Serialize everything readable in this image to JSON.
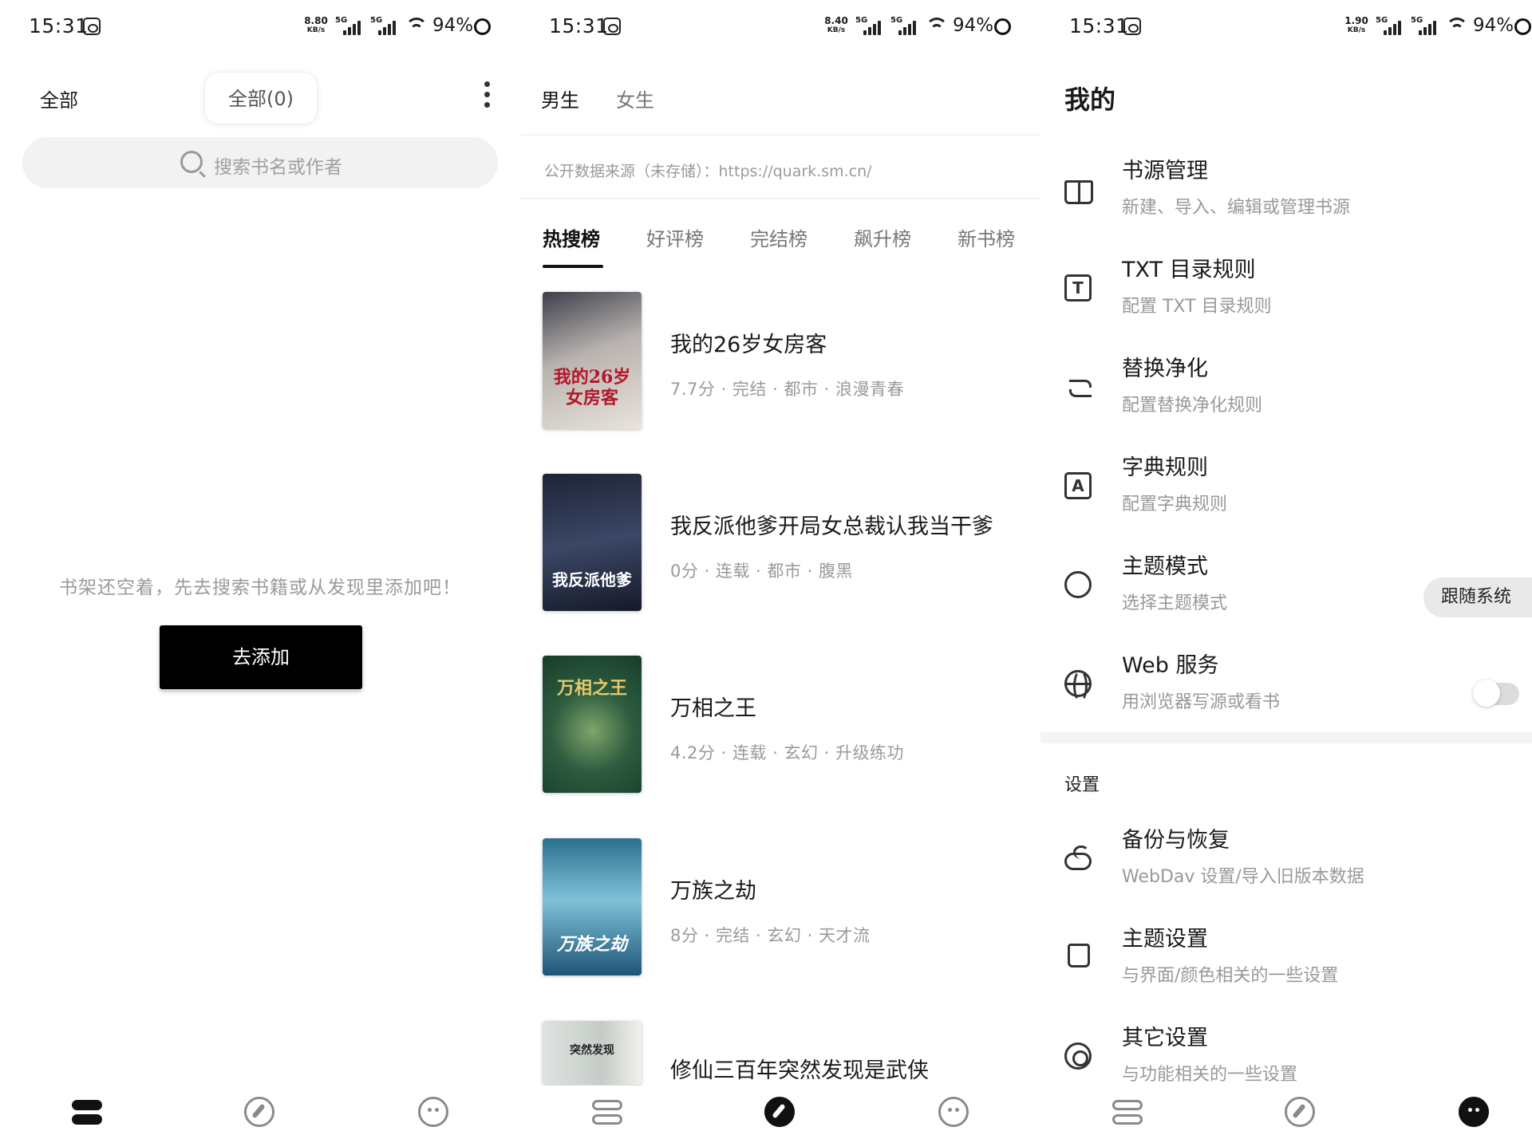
{
  "status_bars": [
    {
      "time": "15:31",
      "speed_value": "8.80",
      "speed_unit": "KB/s",
      "net1": "5G",
      "net2": "5G",
      "battery": "94%"
    },
    {
      "time": "15:31",
      "speed_value": "8.40",
      "speed_unit": "KB/s",
      "net1": "5G",
      "net2": "5G",
      "battery": "94%"
    },
    {
      "time": "15:31",
      "speed_value": "1.90",
      "speed_unit": "KB/s",
      "net1": "5G",
      "net2": "5G",
      "battery": "94%"
    }
  ],
  "bookshelf": {
    "group_tab": "全部",
    "group_chip": "全部(0)",
    "search_placeholder": "搜索书名或作者",
    "empty_message": "书架还空着，先去搜索书籍或从发现里添加吧！",
    "add_button": "去添加"
  },
  "discover": {
    "gender_tabs": [
      "男生",
      "女生"
    ],
    "source_note": "公开数据来源（未存储）：https://quark.sm.cn/",
    "rank_tabs": [
      "热搜榜",
      "好评榜",
      "完结榜",
      "飙升榜",
      "新书榜"
    ],
    "books": [
      {
        "title": "我的26岁女房客",
        "meta": "7.7分 · 完结 · 都市 · 浪漫青春",
        "cover_text": "我的26岁女房客"
      },
      {
        "title": "我反派他爹开局女总裁认我当干爹",
        "meta": "0分 · 连载 · 都市 · 腹黑",
        "cover_text": "我反派他爹"
      },
      {
        "title": "万相之王",
        "meta": "4.2分 · 连载 · 玄幻 · 升级练功",
        "cover_text": "万相之王"
      },
      {
        "title": "万族之劫",
        "meta": "8分 · 完结 · 玄幻 · 天才流",
        "cover_text": "万族之劫"
      },
      {
        "title": "修仙三百年突然发现是武侠",
        "meta": "",
        "cover_text": "突然发现"
      }
    ]
  },
  "mine": {
    "title": "我的",
    "items": [
      {
        "title": "书源管理",
        "subtitle": "新建、导入、编辑或管理书源",
        "icon": "book-open-icon"
      },
      {
        "title": "TXT 目录规则",
        "subtitle": "配置 TXT 目录规则",
        "icon": "txt-box-icon"
      },
      {
        "title": "替换净化",
        "subtitle": "配置替换净化规则",
        "icon": "swap-icon"
      },
      {
        "title": "字典规则",
        "subtitle": "配置字典规则",
        "icon": "dictionary-icon"
      },
      {
        "title": "主题模式",
        "subtitle": "选择主题模式",
        "icon": "theme-mode-icon"
      },
      {
        "title": "Web 服务",
        "subtitle": "用浏览器写源或看书",
        "icon": "globe-icon"
      }
    ],
    "theme_mode_value": "跟随系统",
    "web_service_enabled": false,
    "settings_header": "设置",
    "settings_items": [
      {
        "title": "备份与恢复",
        "subtitle": "WebDav 设置/导入旧版本数据",
        "icon": "cloud-icon"
      },
      {
        "title": "主题设置",
        "subtitle": "与界面/颜色相关的一些设置",
        "icon": "shirt-icon"
      },
      {
        "title": "其它设置",
        "subtitle": "与功能相关的一些设置",
        "icon": "gear-icon"
      }
    ]
  },
  "bottom_nav": {
    "items": [
      "bookshelf-icon",
      "discover-icon",
      "mine-icon"
    ],
    "active_by_panel": [
      "bookshelf",
      "discover",
      "mine"
    ]
  }
}
